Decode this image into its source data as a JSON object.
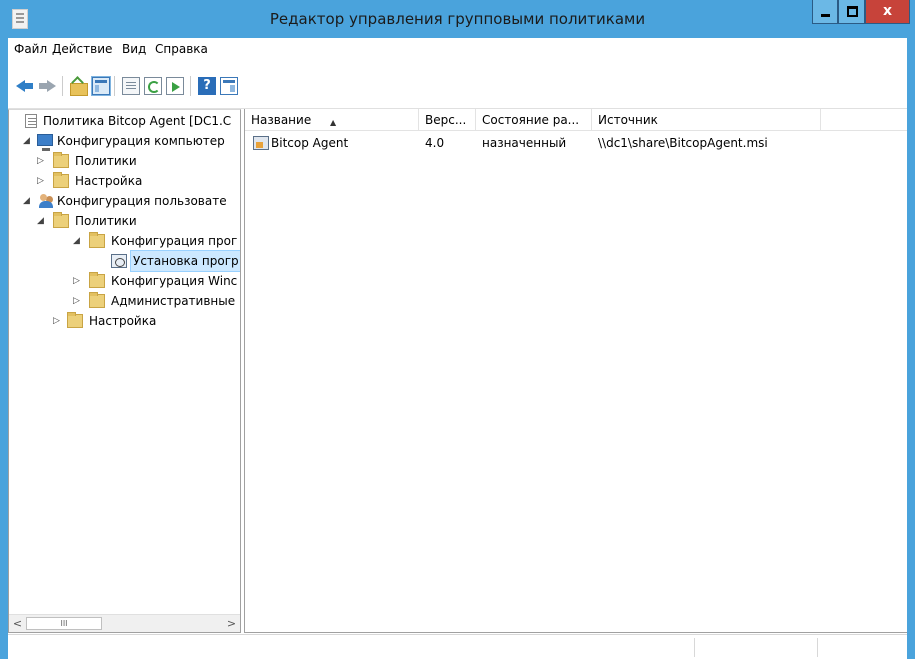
{
  "window": {
    "title": "Редактор управления групповыми политиками",
    "close_glyph": "x",
    "accent_color": "#4aa3dc",
    "close_color": "#c7433a"
  },
  "menu": {
    "items": [
      "Файл",
      "Действие",
      "Вид",
      "Справка"
    ]
  },
  "toolbar": {
    "buttons": [
      "back-icon",
      "forward-icon",
      "folder-up-icon",
      "show-hide-console-tree-icon",
      "page-icon",
      "refresh-icon",
      "export-list-icon",
      "help-icon",
      "properties-icon"
    ],
    "help_glyph": "?"
  },
  "tree": {
    "items": [
      {
        "label": "Политика Bitcop Agent [DC1.C",
        "icon": "policy-icon"
      },
      {
        "label": "Конфигурация компьютер",
        "icon": "computer-icon",
        "expander": "◢"
      },
      {
        "label": "Политики",
        "icon": "folder-icon",
        "expander": "▷"
      },
      {
        "label": "Настройка",
        "icon": "folder-icon",
        "expander": "▷"
      },
      {
        "label": "Конфигурация пользовате",
        "icon": "users-icon",
        "expander": "◢"
      },
      {
        "label": "Политики",
        "icon": "folder-icon",
        "expander": "◢"
      },
      {
        "label": "Конфигурация прог",
        "icon": "folder-icon",
        "expander": "◢"
      },
      {
        "label": "Установка прогр",
        "icon": "software-installation-icon",
        "selected": true
      },
      {
        "label": "Конфигурация Winc",
        "icon": "folder-icon",
        "expander": "▷"
      },
      {
        "label": "Административные",
        "icon": "folder-icon",
        "expander": "▷"
      },
      {
        "label": "Настройка",
        "icon": "folder-icon",
        "expander": "▷"
      }
    ],
    "scroll_left": "<",
    "scroll_right": ">",
    "scroll_thumb": "III"
  },
  "list": {
    "columns": [
      "Название",
      "Верс...",
      "Состояние ра...",
      "Источник"
    ],
    "sort_indicator": "▲",
    "rows": [
      {
        "name": "Bitcop Agent",
        "version": "4.0",
        "state": "назначенный",
        "source": "\\\\dc1\\share\\BitcopAgent.msi"
      }
    ]
  }
}
